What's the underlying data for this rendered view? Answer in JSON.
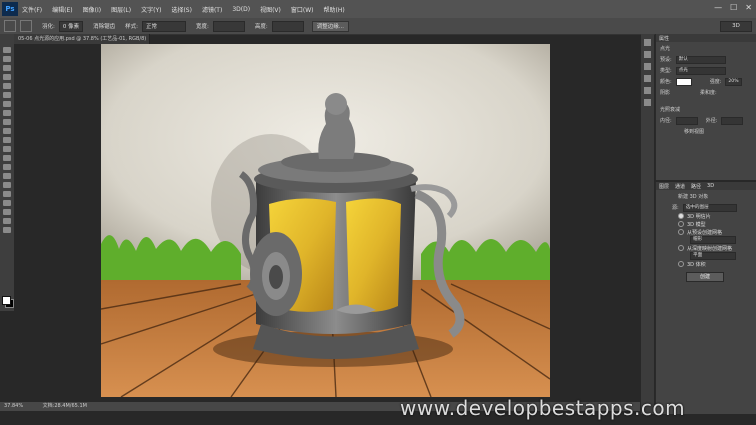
{
  "app": {
    "logo": "Ps"
  },
  "menu": [
    "文件(F)",
    "编辑(E)",
    "图像(I)",
    "图层(L)",
    "文字(Y)",
    "选择(S)",
    "滤镜(T)",
    "3D(D)",
    "视图(V)",
    "窗口(W)",
    "帮助(H)"
  ],
  "window": {
    "minimize": "—",
    "restore": "☐",
    "close": "✕"
  },
  "options": {
    "feather_label": "羽化:",
    "feather_value": "0 像素",
    "antialias": "消除锯齿",
    "style_label": "样式:",
    "style_value": "正常",
    "width_label": "宽度:",
    "height_label": "高度:",
    "refine_edge": "调整边缘...",
    "workspace": "3D"
  },
  "document": {
    "tab": "05-06 点光源的应用.psd @ 37.8% (工艺品-01, RGB/8) *"
  },
  "status": {
    "zoom": "37.84%",
    "doc_size": "文档:28.4M/65.1M"
  },
  "properties": {
    "tabs": "属性",
    "header": "点光",
    "preset_label": "预设:",
    "preset_value": "默认",
    "type_label": "类型:",
    "type_value": "点光",
    "color_label": "颜色:",
    "intensity_label": "强度:",
    "intensity_value": "20%",
    "shadow_label": "阴影",
    "softness_label": "柔和度:",
    "light_falloff": "光照衰减",
    "inner_label": "内径:",
    "outer_label": "外径:",
    "origin_btn": "移到视图"
  },
  "panel3d": {
    "tabs": [
      "图层",
      "通道",
      "路径",
      "3D"
    ],
    "new_object": "新建 3D 对象",
    "source_label": "源:",
    "source_value": "选中的图层",
    "options": [
      {
        "label": "3D 明信片",
        "selected": true
      },
      {
        "label": "3D 模型",
        "selected": false
      },
      {
        "label": "从预设创建网格",
        "selected": false
      },
      {
        "label": "帽形",
        "selected": false
      },
      {
        "label": "从深度映射创建网格",
        "selected": false
      },
      {
        "label": "平面",
        "selected": false
      },
      {
        "label": "3D 体积",
        "selected": false
      }
    ],
    "create_btn": "创建"
  },
  "watermark": "www.developbestapps.com"
}
